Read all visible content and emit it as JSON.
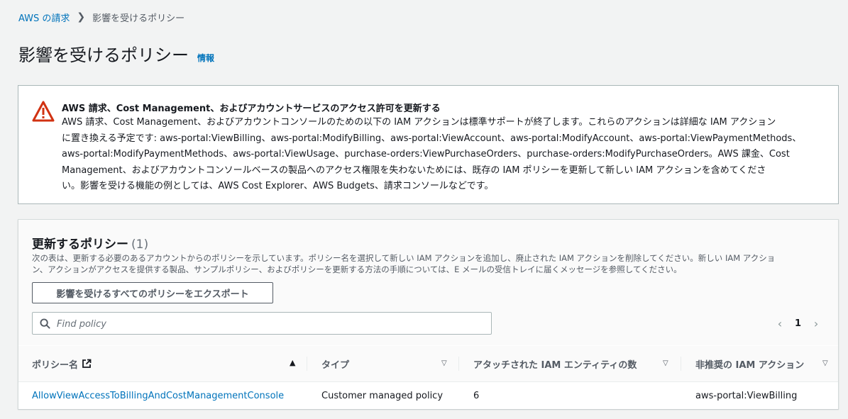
{
  "breadcrumb": {
    "root": "AWS の請求",
    "current": "影響を受けるポリシー"
  },
  "page": {
    "title": "影響を受けるポリシー",
    "info_link": "情報"
  },
  "alert": {
    "title": "AWS 請求、Cost Management、およびアカウントサービスのアクセス許可を更新する",
    "lines": [
      "AWS 請求、Cost Management、およびアカウントコンソールのための以下の IAM アクションは標準サポートが終了します。これらのアクションは詳細な IAM アクション",
      "に置き換える予定です: aws-portal:ViewBilling、aws-portal:ModifyBilling、aws-portal:ViewAccount、aws-portal:ModifyAccount、aws-portal:ViewPaymentMethods、",
      "aws-portal:ModifyPaymentMethods、aws-portal:ViewUsage、purchase-orders:ViewPurchaseOrders、purchase-orders:ModifyPurchaseOrders。AWS 課金、Cost",
      "Management、およびアカウントコンソールベースの製品へのアクセス権限を失わないためには、既存の IAM ポリシーを更新して新しい IAM アクションを含めてくださ",
      "い。影響を受ける機能の例としては、AWS Cost Explorer、AWS Budgets、請求コンソールなどです。"
    ]
  },
  "policies_panel": {
    "title": "更新するポリシー",
    "count": "(1)",
    "description_lines": [
      "次の表は、更新する必要のあるアカウントからのポリシーを示しています。ポリシー名を選択して新しい IAM アクションを追加し、廃止された IAM アクションを削除してください。新しい IAM アクショ",
      "ン、アクションがアクセスを提供する製品、サンプルポリシー、およびポリシーを更新する方法の手順については、E メールの受信トレイに届くメッセージを参照してください。"
    ],
    "export_button": "影響を受けるすべてのポリシーをエクスポート",
    "search_placeholder": "Find policy",
    "current_page": "1",
    "columns": [
      "ポリシー名",
      "タイプ",
      "アタッチされた IAM エンティティの数",
      "非推奨の IAM アクション"
    ],
    "rows": [
      {
        "policy_name": "AllowViewAccessToBillingAndCostManagementConsole",
        "type": "Customer managed policy",
        "attached_entities": "6",
        "deprecated_actions": "aws-portal:ViewBilling"
      }
    ]
  },
  "colors": {
    "link": "#0073bb",
    "warning": "#d13212",
    "background": "#f2f3f3"
  }
}
